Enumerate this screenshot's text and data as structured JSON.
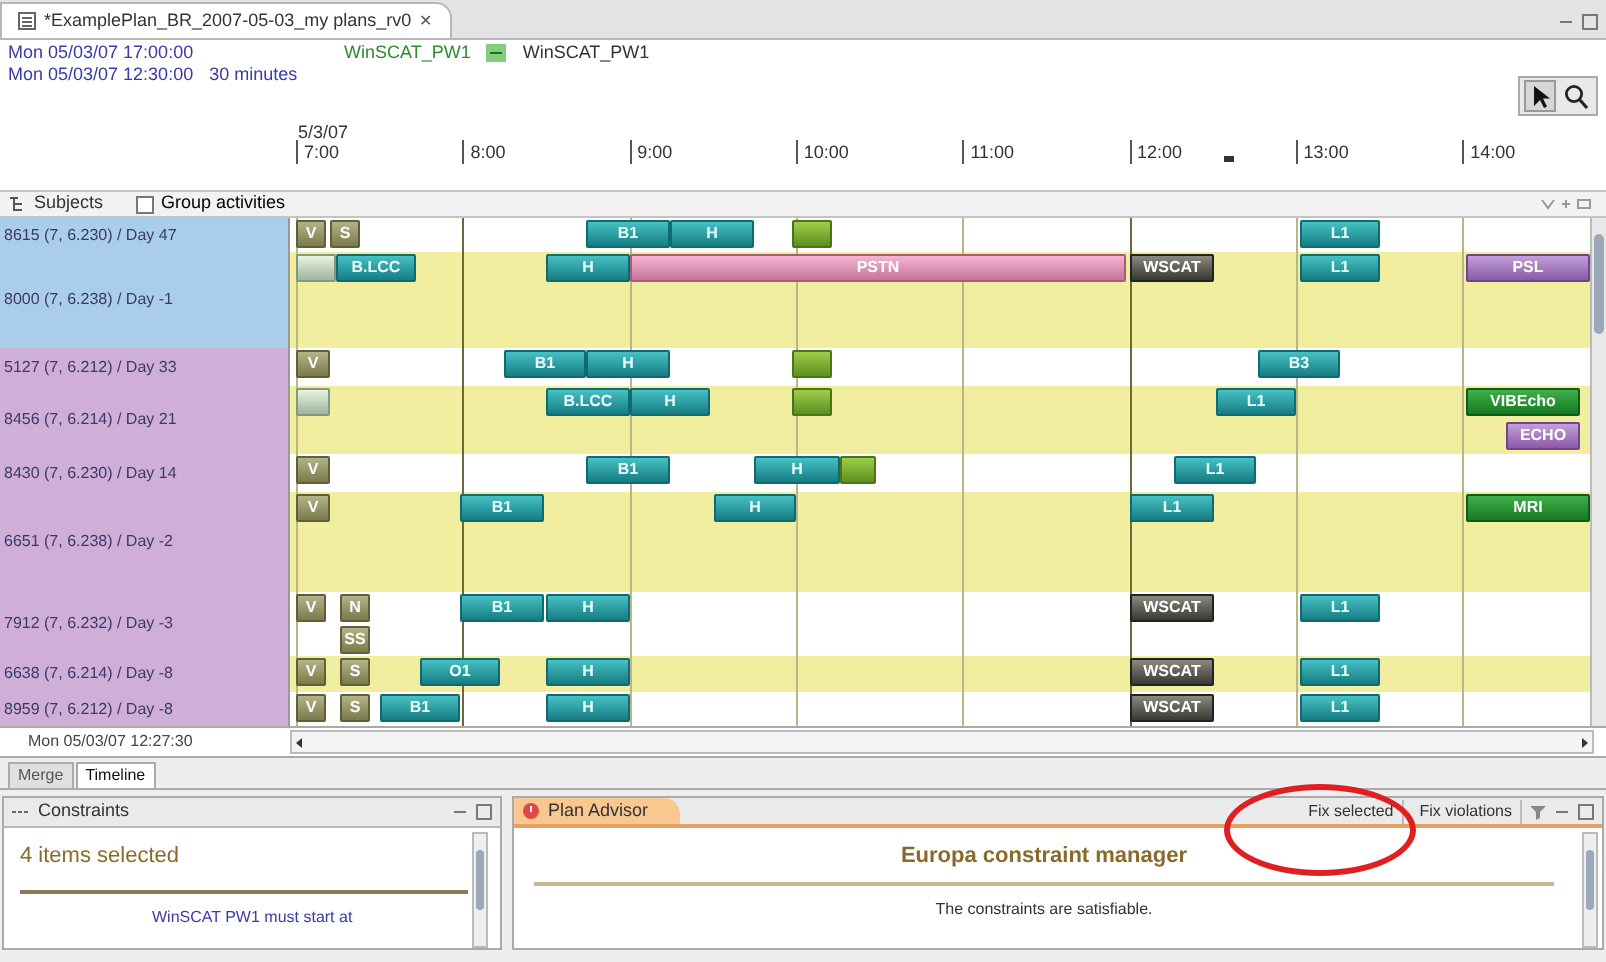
{
  "editor_tab": {
    "title": "*ExamplePlan_BR_2007-05-03_my plans_rv0",
    "close": "✕"
  },
  "info": {
    "start": "Mon 05/03/07 17:00:00",
    "end": "Mon 05/03/07 12:30:00",
    "resolution": "30 minutes",
    "activity_a": "WinSCAT_PW1",
    "activity_b": "WinSCAT_PW1"
  },
  "ruler": {
    "date": "5/3/07",
    "hours": [
      "7:00",
      "8:00",
      "9:00",
      "10:00",
      "11:00",
      "12:00",
      "13:00",
      "14:00"
    ]
  },
  "subjects_bar": {
    "title": "Subjects",
    "group_activities": {
      "label": "Group activities",
      "checked": false
    }
  },
  "subjects": [
    {
      "label": "8615 (7, 6.230) / Day 47",
      "color": "#a9cdea",
      "shaded": false,
      "bars": [
        {
          "kind": "olive",
          "label": "V"
        },
        {
          "kind": "olive",
          "label": "S"
        },
        {
          "kind": "teal",
          "label": "B1"
        },
        {
          "kind": "teal",
          "label": "H"
        },
        {
          "kind": "green"
        },
        {
          "kind": "teal",
          "label": "L1"
        }
      ]
    },
    {
      "label": "8000 (7, 6.238) / Day -1",
      "color": "#a9cdea",
      "shaded": true,
      "bars": [
        {
          "kind": "pale"
        },
        {
          "kind": "teal",
          "label": "B.LCC"
        },
        {
          "kind": "teal",
          "label": "H"
        },
        {
          "kind": "pink",
          "label": "PSTN"
        },
        {
          "kind": "dark",
          "label": "WSCAT"
        },
        {
          "kind": "teal",
          "label": "L1"
        },
        {
          "kind": "purple",
          "label": "PSL"
        }
      ]
    },
    {
      "label": "5127 (7, 6.212) / Day 33",
      "color": "#cfaed8",
      "shaded": false,
      "bars": [
        {
          "kind": "olive",
          "label": "V"
        },
        {
          "kind": "teal",
          "label": "B1"
        },
        {
          "kind": "teal",
          "label": "H"
        },
        {
          "kind": "green"
        },
        {
          "kind": "teal",
          "label": "B3"
        }
      ]
    },
    {
      "label": "8456 (7, 6.214) / Day 21",
      "color": "#cfaed8",
      "shaded": true,
      "bars": [
        {
          "kind": "pale"
        },
        {
          "kind": "teal",
          "label": "B.LCC"
        },
        {
          "kind": "teal",
          "label": "H"
        },
        {
          "kind": "green"
        },
        {
          "kind": "teal",
          "label": "L1"
        },
        {
          "kind": "darkgreen",
          "label": "VIBEcho"
        },
        {
          "kind": "purple",
          "label": "ECHO"
        }
      ]
    },
    {
      "label": "8430 (7, 6.230) / Day 14",
      "color": "#cfaed8",
      "shaded": false,
      "bars": [
        {
          "kind": "olive",
          "label": "V"
        },
        {
          "kind": "teal",
          "label": "B1"
        },
        {
          "kind": "teal",
          "label": "H"
        },
        {
          "kind": "green"
        },
        {
          "kind": "teal",
          "label": "L1"
        }
      ]
    },
    {
      "label": "6651 (7, 6.238) / Day -2",
      "color": "#cfaed8",
      "shaded": true,
      "bars": [
        {
          "kind": "olive",
          "label": "V"
        },
        {
          "kind": "teal",
          "label": "B1"
        },
        {
          "kind": "teal",
          "label": "H"
        },
        {
          "kind": "teal",
          "label": "L1"
        },
        {
          "kind": "darkgreen",
          "label": "MRI"
        }
      ]
    },
    {
      "label": "7912 (7, 6.232) / Day -3",
      "color": "#cfaed8",
      "shaded": false,
      "bars": [
        {
          "kind": "olive",
          "label": "V"
        },
        {
          "kind": "olive",
          "label": "N"
        },
        {
          "kind": "olive",
          "label": "SS"
        },
        {
          "kind": "teal",
          "label": "B1"
        },
        {
          "kind": "teal",
          "label": "H"
        },
        {
          "kind": "dark",
          "label": "WSCAT"
        },
        {
          "kind": "teal",
          "label": "L1"
        }
      ]
    },
    {
      "label": "6638 (7, 6.214) / Day -8",
      "color": "#cfaed8",
      "shaded": true,
      "bars": [
        {
          "kind": "olive",
          "label": "V"
        },
        {
          "kind": "olive",
          "label": "S"
        },
        {
          "kind": "teal",
          "label": "O1"
        },
        {
          "kind": "teal",
          "label": "H"
        },
        {
          "kind": "dark",
          "label": "WSCAT"
        },
        {
          "kind": "teal",
          "label": "L1"
        }
      ]
    },
    {
      "label": "8959 (7, 6.212) / Day -8",
      "color": "#cfaed8",
      "shaded": false,
      "bars": [
        {
          "kind": "olive",
          "label": "V"
        },
        {
          "kind": "olive",
          "label": "S"
        },
        {
          "kind": "teal",
          "label": "B1"
        },
        {
          "kind": "teal",
          "label": "H"
        },
        {
          "kind": "dark",
          "label": "WSCAT"
        },
        {
          "kind": "teal",
          "label": "L1"
        }
      ]
    }
  ],
  "cursor_time": "Mon 05/03/07 12:27:30",
  "view_tabs": [
    {
      "label": "Merge",
      "selected": false
    },
    {
      "label": "Timeline",
      "selected": true
    }
  ],
  "constraints_panel": {
    "title": "Constraints",
    "summary": "4 items selected",
    "item": "WinSCAT PW1 must start at"
  },
  "advisor_panel": {
    "title": "Plan Advisor",
    "actions": [
      "Fix selected",
      "Fix violations"
    ],
    "heading": "Europa constraint manager",
    "message": "The constraints are satisfiable."
  }
}
